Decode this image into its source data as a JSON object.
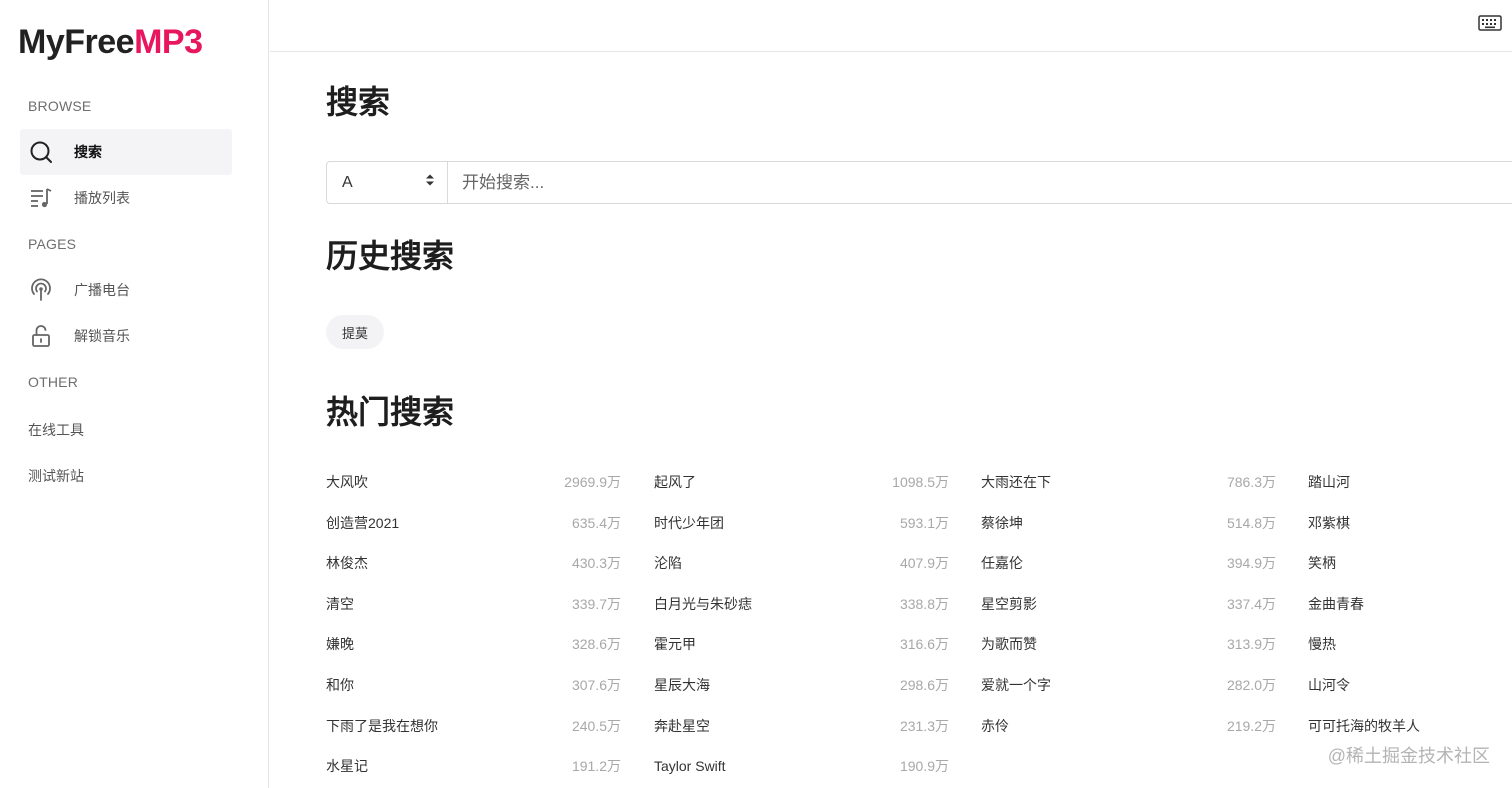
{
  "logo": {
    "part1": "MyFree",
    "part2": "MP3"
  },
  "sidebar": {
    "browse_label": "BROWSE",
    "browse_items": [
      {
        "label": "搜索",
        "icon": "search-icon"
      },
      {
        "label": "播放列表",
        "icon": "playlist-icon"
      }
    ],
    "pages_label": "PAGES",
    "pages_items": [
      {
        "label": "广播电台",
        "icon": "radio-icon"
      },
      {
        "label": "解锁音乐",
        "icon": "unlock-icon"
      }
    ],
    "other_label": "OTHER",
    "other_items": [
      {
        "label": "在线工具"
      },
      {
        "label": "测试新站"
      }
    ]
  },
  "topbar": {
    "icon": "keyboard-icon"
  },
  "search": {
    "title": "搜索",
    "source_value": "A",
    "placeholder": "开始搜索..."
  },
  "history": {
    "title": "历史搜索",
    "items": [
      "提莫"
    ]
  },
  "hot": {
    "title": "热门搜索",
    "items": [
      {
        "keyword": "大风吹",
        "count": "2969.9万"
      },
      {
        "keyword": "起风了",
        "count": "1098.5万"
      },
      {
        "keyword": "大雨还在下",
        "count": "786.3万"
      },
      {
        "keyword": "踏山河",
        "count": ""
      },
      {
        "keyword": "创造营2021",
        "count": "635.4万"
      },
      {
        "keyword": "时代少年团",
        "count": "593.1万"
      },
      {
        "keyword": "蔡徐坤",
        "count": "514.8万"
      },
      {
        "keyword": "邓紫棋",
        "count": ""
      },
      {
        "keyword": "林俊杰",
        "count": "430.3万"
      },
      {
        "keyword": "沦陷",
        "count": "407.9万"
      },
      {
        "keyword": "任嘉伦",
        "count": "394.9万"
      },
      {
        "keyword": "笑柄",
        "count": ""
      },
      {
        "keyword": "清空",
        "count": "339.7万"
      },
      {
        "keyword": "白月光与朱砂痣",
        "count": "338.8万"
      },
      {
        "keyword": "星空剪影",
        "count": "337.4万"
      },
      {
        "keyword": "金曲青春",
        "count": ""
      },
      {
        "keyword": "嫌晚",
        "count": "328.6万"
      },
      {
        "keyword": "霍元甲",
        "count": "316.6万"
      },
      {
        "keyword": "为歌而赞",
        "count": "313.9万"
      },
      {
        "keyword": "慢热",
        "count": ""
      },
      {
        "keyword": "和你",
        "count": "307.6万"
      },
      {
        "keyword": "星辰大海",
        "count": "298.6万"
      },
      {
        "keyword": "爱就一个字",
        "count": "282.0万"
      },
      {
        "keyword": "山河令",
        "count": ""
      },
      {
        "keyword": "下雨了是我在想你",
        "count": "240.5万"
      },
      {
        "keyword": "奔赴星空",
        "count": "231.3万"
      },
      {
        "keyword": "赤伶",
        "count": "219.2万"
      },
      {
        "keyword": "可可托海的牧羊人",
        "count": ""
      },
      {
        "keyword": "水星记",
        "count": "191.2万"
      },
      {
        "keyword": "Taylor Swift",
        "count": "190.9万"
      }
    ]
  },
  "watermark": "@稀土掘金技术社区"
}
